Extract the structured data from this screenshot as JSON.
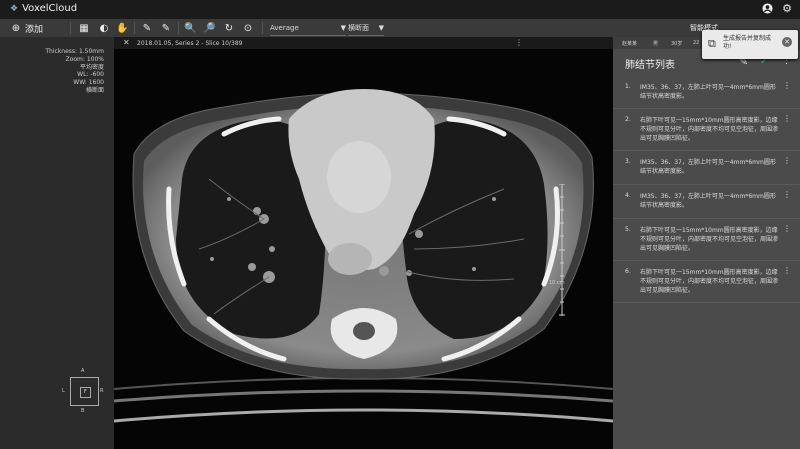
{
  "app": {
    "brand": "VoxelCloud",
    "user_icon": "account-circle-icon",
    "settings_icon": "gear-icon"
  },
  "toolbar": {
    "add_label": "添加",
    "window_preset": "Average",
    "view_plane": "横断面",
    "smart_mode_label": "智能模式",
    "icons": [
      "layout-icon",
      "contrast-icon",
      "pan-hand-icon",
      "pen-icon",
      "pen-icon",
      "zoom-in-icon",
      "zoom-out-icon",
      "rotate-icon",
      "play-icon"
    ]
  },
  "viewer": {
    "header": "2018.01.05, Series 2 - Slice 10/389",
    "info": [
      "Thickness: 1.50mm",
      "Zoom: 100%",
      "平均密度",
      "WL: -600",
      "WW: 1600",
      "横断面"
    ],
    "scale_label": "10 cm",
    "orientation": {
      "top": "A",
      "bottom": "B",
      "left": "L",
      "right": "R",
      "center": "F"
    }
  },
  "right_panel": {
    "tabs": [
      "赵某某",
      "男",
      "30岁",
      "22"
    ],
    "title": "肺结节列表",
    "findings": [
      {
        "num": "1.",
        "text": "IM35、36、37，左肺上叶可见一4mm*6mm圆形结节状高密度影。"
      },
      {
        "num": "2.",
        "text": "右肺下叶可见一15mm*10mm圆形高密度影，边缘不规则可见分叶，内部密度不均可见空泡征，周围渗出可见胸膜凹陷征。"
      },
      {
        "num": "3.",
        "text": "IM35、36、37，左肺上叶可见一4mm*6mm圆形结节状高密度影。"
      },
      {
        "num": "4.",
        "text": "IM35、36、37，左肺上叶可见一4mm*6mm圆形结节状高密度影。"
      },
      {
        "num": "5.",
        "text": "右肺下叶可见一15mm*10mm圆形高密度影，边缘不规则可见分叶，内部密度不均可见空泡征，周围渗出可见胸膜凹陷征。"
      },
      {
        "num": "6.",
        "text": "右肺下叶可见一15mm*10mm圆形高密度影，边缘不规则可见分叶，内部密度不均可见空泡征，周围渗出可见胸膜凹陷征。"
      }
    ]
  },
  "toast": {
    "text": "生成报告并复制成功!"
  },
  "colors": {
    "accent_check": "#5fb09a",
    "panel_bg": "#4b4b4b",
    "toolbar_bg": "#3a3a3a"
  }
}
